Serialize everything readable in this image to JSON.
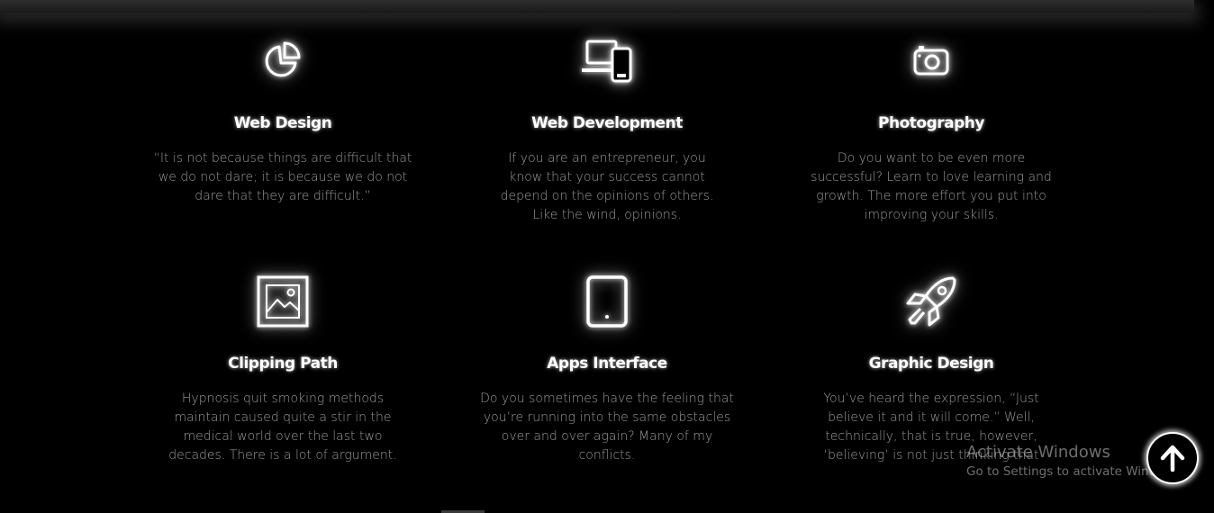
{
  "services": [
    {
      "icon": "pie-chart-icon",
      "title": "Web Design",
      "description": "“It is not because things are difficult that we do not dare; it is because we do not dare that they are difficult.”"
    },
    {
      "icon": "devices-icon",
      "title": "Web Development",
      "description": "If you are an entrepreneur, you know that your success cannot depend on the opinions of others. Like the wind, opinions."
    },
    {
      "icon": "camera-icon",
      "title": "Photography",
      "description": "Do you want to be even more successful? Learn to love learning and growth. The more effort you put into improving your skills."
    },
    {
      "icon": "image-frame-icon",
      "title": "Clipping Path",
      "description": "Hypnosis quit smoking methods maintain caused quite a stir in the medical world over the last two decades. There is a lot of argument."
    },
    {
      "icon": "tablet-icon",
      "title": "Apps Interface",
      "description": "Do you sometimes have the feeling that you’re running into the same obstacles over and over again? Many of my conflicts."
    },
    {
      "icon": "rocket-icon",
      "title": "Graphic Design",
      "description": "You’ve heard the expression, “Just believe it and it will come.” Well, technically, that is true, however, ‘believing’ is not just thinking that"
    }
  ],
  "windows_activation": {
    "title": "Activate Windows",
    "subtitle": "Go to Settings to activate Windows."
  },
  "scroll_top": {
    "icon": "arrow-up-icon"
  }
}
